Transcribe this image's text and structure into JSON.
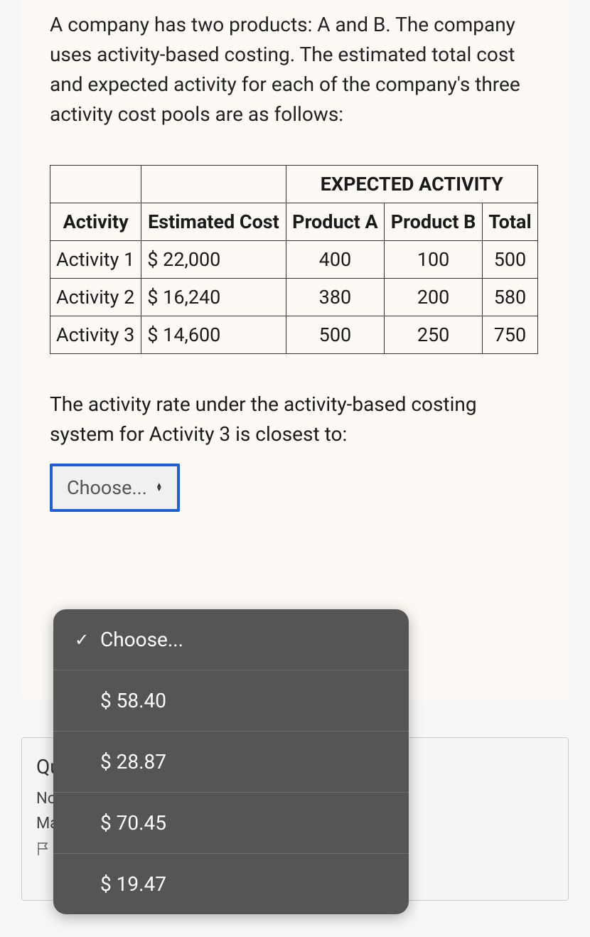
{
  "question": {
    "intro": "A company has two products: A and B. The company uses activity-based costing. The estimated total cost and expected activity for each of the company's three activity cost pools are as follows:",
    "followup": "The activity rate under the activity-based costing system for Activity 3 is closest to:"
  },
  "table": {
    "header_span": "EXPECTED ACTIVITY",
    "cols": {
      "activity": "Activity",
      "est_cost": "Estimated Cost",
      "prod_a": "Product A",
      "prod_b": "Product B",
      "total": "Total"
    },
    "rows": [
      {
        "activity": "Activity 1",
        "cost": "$ 22,000",
        "a": "400",
        "b": "100",
        "total": "500"
      },
      {
        "activity": "Activity 2",
        "cost": "$ 16,240",
        "a": "380",
        "b": "200",
        "total": "580"
      },
      {
        "activity": "Activity 3",
        "cost": "$ 14,600",
        "a": "500",
        "b": "250",
        "total": "750"
      }
    ]
  },
  "dropdown": {
    "placeholder": "Choose...",
    "options": [
      {
        "label": "Choose...",
        "selected": true
      },
      {
        "label": "$ 58.40",
        "selected": false
      },
      {
        "label": "$ 28.87",
        "selected": false
      },
      {
        "label": "$ 70.45",
        "selected": false
      },
      {
        "label": "$ 19.47",
        "selected": false
      }
    ]
  },
  "meta": {
    "line1": "Qu",
    "line2": "No",
    "line3": "Ma"
  },
  "chart_data": {
    "type": "table",
    "title": "Activity-based costing: estimated cost and expected activity",
    "columns": [
      "Activity",
      "Estimated Cost",
      "Product A",
      "Product B",
      "Total"
    ],
    "rows": [
      [
        "Activity 1",
        22000,
        400,
        100,
        500
      ],
      [
        "Activity 2",
        16240,
        380,
        200,
        580
      ],
      [
        "Activity 3",
        14600,
        500,
        250,
        750
      ]
    ]
  }
}
